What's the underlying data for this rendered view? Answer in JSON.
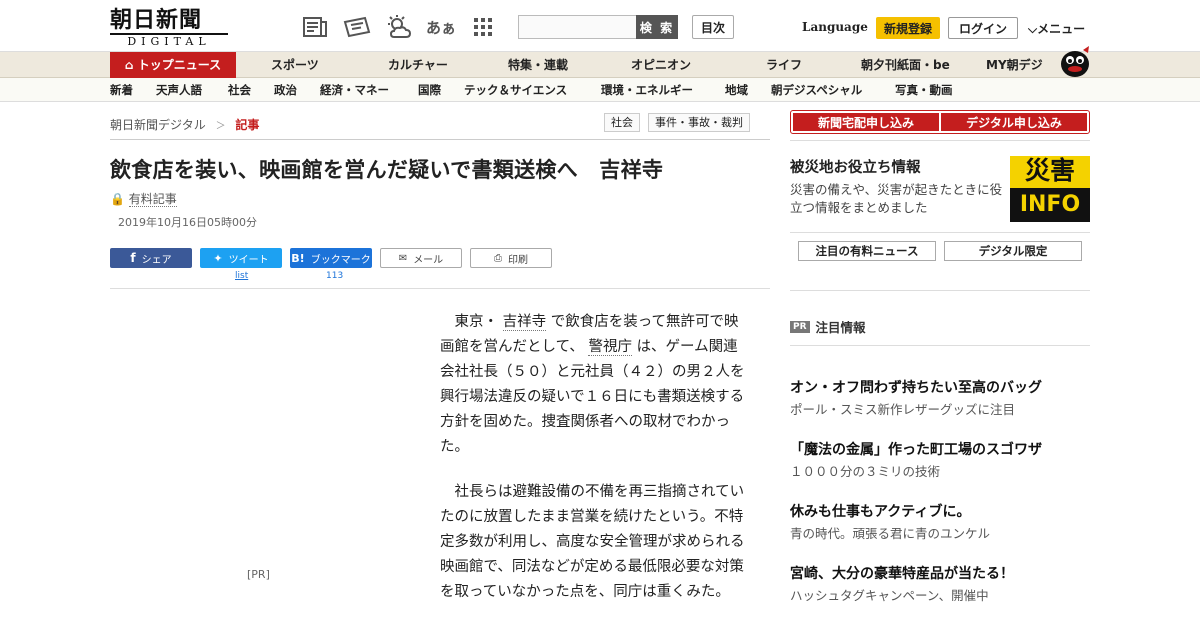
{
  "header": {
    "logo_main": "朝日新聞",
    "logo_sub": "DIGITAL",
    "search_button": "検 索",
    "mokuji": "目次",
    "language": "Language",
    "signup": "新規登録",
    "login": "ログイン",
    "menu": "メニュー",
    "icons": [
      "newspaper-icon",
      "ticket-icon",
      "weather-icon",
      "font-size-icon",
      "grid-icon"
    ],
    "font_icon_text": "あぁ"
  },
  "nav_primary": [
    {
      "label": "トップニュース"
    },
    {
      "label": "スポーツ"
    },
    {
      "label": "カルチャー"
    },
    {
      "label": "特集・連載"
    },
    {
      "label": "オピニオン"
    },
    {
      "label": "ライフ"
    },
    {
      "label": "朝夕刊紙面・be"
    },
    {
      "label": "MY朝デジ"
    }
  ],
  "nav_secondary": [
    {
      "label": "新着"
    },
    {
      "label": "天声人語"
    },
    {
      "label": "社会"
    },
    {
      "label": "政治"
    },
    {
      "label": "経済・マネー"
    },
    {
      "label": "国際"
    },
    {
      "label": "テック＆サイエンス"
    },
    {
      "label": "環境・エネルギー"
    },
    {
      "label": "地域"
    },
    {
      "label": "朝デジスペシャル"
    },
    {
      "label": "写真・動画"
    }
  ],
  "breadcrumb": {
    "home": "朝日新聞デジタル",
    "sep": "＞",
    "current": "記事"
  },
  "tags": [
    "社会",
    "事件・事故・裁判"
  ],
  "article": {
    "title": "飲食店を装い、映画館を営んだ疑いで書類送検へ　吉祥寺",
    "paid_label": "有料記事",
    "date": "2019年10月16日05時00分",
    "p1_pre": "東京・",
    "p1_link1": "吉祥寺",
    "p1_mid": "で飲食店を装って無許可で映画館を営んだとして、",
    "p1_link2": "警視庁",
    "p1_post": "は、ゲーム関連会社社長（５０）と元社員（４２）の男２人を興行場法違反の疑いで１６日にも書類送検する方針を固めた。捜査関係者への取材でわかった。",
    "p2": "社長らは避難設備の不備を再三指摘されていたのに放置したまま営業を続けたという。不特定多数が利用し、高度な安全管理が求められる映画館で、同法などが定める最低限必要な対策を取っていなかった点を、同庁は重くみた。"
  },
  "share": {
    "facebook": "シェア",
    "twitter": "ツイート",
    "twitter_count": "list",
    "hatena": "ブックマーク",
    "hatena_count": "113",
    "mail": "メール",
    "print": "印刷"
  },
  "pr_left": "[PR]",
  "sidebar": {
    "btn_home": "新聞宅配申し込み",
    "btn_digital": "デジタル申し込み",
    "saigai_title": "被災地お役立ち情報",
    "saigai_desc": "災害の備えや、災害が起きたときに役立つ情報をまとめました",
    "saigai_img_top": "災害",
    "saigai_img_bottom": "INFO",
    "tab1": "注目の有料ニュース",
    "tab2": "デジタル限定",
    "pr_badge": "PR",
    "pr_title": "注目情報",
    "ads": [
      {
        "h": "オン・オフ問わず持ちたい至高のバッグ",
        "s": "ポール・スミス新作レザーグッズに注目"
      },
      {
        "h": "「魔法の金属」作った町工場のスゴワザ",
        "s": "１０００分の３ミリの技術"
      },
      {
        "h": "休みも仕事もアクティブに。",
        "s": "青の時代。頑張る君に青のユンケル"
      },
      {
        "h": "宮崎、大分の豪華特産品が当たる！",
        "s": "ハッシュタグキャンペーン、開催中"
      }
    ]
  },
  "colors": {
    "brand_red": "#c41e1e",
    "signup_yellow": "#f5c000",
    "facebook": "#3b5998",
    "twitter": "#1da1f2",
    "hatena": "#1c73d9"
  }
}
